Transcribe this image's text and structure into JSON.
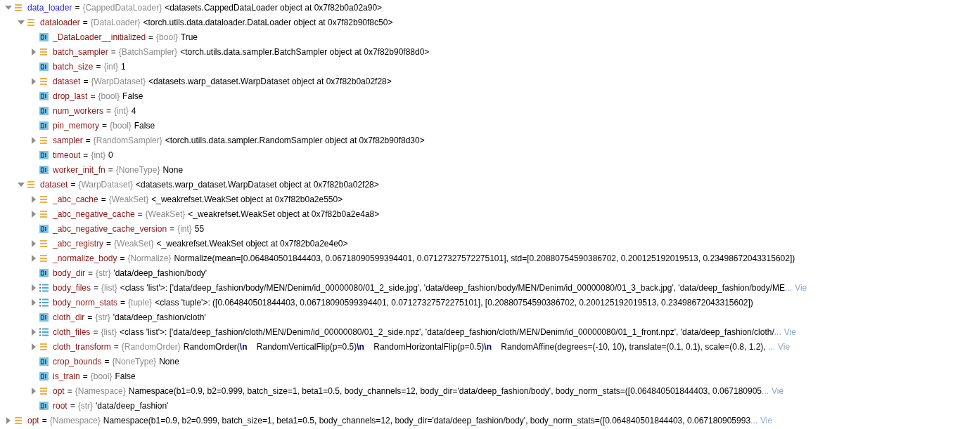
{
  "variables": [
    {
      "kind": "object",
      "name": "data_loader",
      "changed": true,
      "eq": "=",
      "type": "{CappedDataLoader}",
      "value": "<datasets.CappedDataLoader object at 0x7f82b0a02a90>",
      "expanded": true,
      "children": [
        {
          "kind": "object",
          "name": "dataloader",
          "changed": false,
          "eq": "=",
          "type": "{DataLoader}",
          "value": "<torch.utils.data.dataloader.DataLoader object at 0x7f82b90f8c50>",
          "expanded": true,
          "children": [
            {
              "kind": "primitive",
              "name": "_DataLoader__initialized",
              "changed": false,
              "eq": "=",
              "type": "{bool}",
              "value": "True"
            },
            {
              "kind": "object",
              "name": "batch_sampler",
              "changed": false,
              "eq": "=",
              "type": "{BatchSampler}",
              "value": "<torch.utils.data.sampler.BatchSampler object at 0x7f82b90f88d0>",
              "expanded": false
            },
            {
              "kind": "primitive",
              "name": "batch_size",
              "changed": false,
              "eq": "=",
              "type": "{int}",
              "value": "1"
            },
            {
              "kind": "object",
              "name": "dataset",
              "changed": false,
              "eq": "=",
              "type": "{WarpDataset}",
              "value": "<datasets.warp_dataset.WarpDataset object at 0x7f82b0a02f28>",
              "expanded": false
            },
            {
              "kind": "primitive",
              "name": "drop_last",
              "changed": false,
              "eq": "=",
              "type": "{bool}",
              "value": "False"
            },
            {
              "kind": "primitive",
              "name": "num_workers",
              "changed": false,
              "eq": "=",
              "type": "{int}",
              "value": "4"
            },
            {
              "kind": "primitive",
              "name": "pin_memory",
              "changed": false,
              "eq": "=",
              "type": "{bool}",
              "value": "False"
            },
            {
              "kind": "object",
              "name": "sampler",
              "changed": false,
              "eq": "=",
              "type": "{RandomSampler}",
              "value": "<torch.utils.data.sampler.RandomSampler object at 0x7f82b90f8d30>",
              "expanded": false
            },
            {
              "kind": "primitive",
              "name": "timeout",
              "changed": false,
              "eq": "=",
              "type": "{int}",
              "value": "0"
            },
            {
              "kind": "primitive",
              "name": "worker_init_fn",
              "changed": false,
              "eq": "=",
              "type": "{NoneType}",
              "value": "None"
            }
          ]
        },
        {
          "kind": "object",
          "name": "dataset",
          "changed": false,
          "eq": "=",
          "type": "{WarpDataset}",
          "value": "<datasets.warp_dataset.WarpDataset object at 0x7f82b0a02f28>",
          "expanded": true,
          "children": [
            {
              "kind": "object",
              "name": "_abc_cache",
              "changed": false,
              "eq": "=",
              "type": "{WeakSet}",
              "value": "<_weakrefset.WeakSet object at 0x7f82b0a2e550>",
              "expanded": false
            },
            {
              "kind": "object",
              "name": "_abc_negative_cache",
              "changed": false,
              "eq": "=",
              "type": "{WeakSet}",
              "value": "<_weakrefset.WeakSet object at 0x7f82b0a2e4a8>",
              "expanded": false
            },
            {
              "kind": "primitive",
              "name": "_abc_negative_cache_version",
              "changed": false,
              "eq": "=",
              "type": "{int}",
              "value": "55"
            },
            {
              "kind": "object",
              "name": "_abc_registry",
              "changed": false,
              "eq": "=",
              "type": "{WeakSet}",
              "value": "<_weakrefset.WeakSet object at 0x7f82b0a2e4e0>",
              "expanded": false
            },
            {
              "kind": "object",
              "name": "_normalize_body",
              "changed": false,
              "eq": "=",
              "type": "{Normalize}",
              "value": "Normalize(mean=[0.064840501844403, 0.06718090599394401, 0.07127327572275101], std=[0.20880754590386702, 0.200125192019513, 0.23498672043315602])",
              "expanded": false
            },
            {
              "kind": "primitive",
              "name": "body_dir",
              "changed": false,
              "eq": "=",
              "type": "{str}",
              "value": "'data/deep_fashion/body'"
            },
            {
              "kind": "list",
              "name": "body_files",
              "changed": false,
              "eq": "=",
              "type": "{list}",
              "value": "<class 'list'>: ['data/deep_fashion/body/MEN/Denim/id_00000080/01_2_side.jpg', 'data/deep_fashion/body/MEN/Denim/id_00000080/01_3_back.jpg', 'data/deep_fashion/body/ME",
              "ellipsis": "...",
              "link": "Vie",
              "expanded": false
            },
            {
              "kind": "list",
              "name": "body_norm_stats",
              "changed": false,
              "eq": "=",
              "type": "{tuple}",
              "value": "<class 'tuple'>: ([0.064840501844403, 0.06718090599394401, 0.07127327572275101], [0.20880754590386702, 0.200125192019513, 0.23498672043315602])",
              "expanded": false
            },
            {
              "kind": "primitive",
              "name": "cloth_dir",
              "changed": false,
              "eq": "=",
              "type": "{str}",
              "value": "'data/deep_fashion/cloth'"
            },
            {
              "kind": "list",
              "name": "cloth_files",
              "changed": false,
              "eq": "=",
              "type": "{list}",
              "value": "<class 'list'>: ['data/deep_fashion/cloth/MEN/Denim/id_00000080/01_2_side.npz', 'data/deep_fashion/cloth/MEN/Denim/id_00000080/01_1_front.npz', 'data/deep_fashion/cloth/",
              "ellipsis": "...",
              "link": "Vie",
              "expanded": false
            },
            {
              "kind": "object",
              "name": "cloth_transform",
              "changed": false,
              "eq": "=",
              "type": "{RandomOrder}",
              "value": "RandomOrder(**\\n**    RandomVerticalFlip(p=0.5)**\\n**    RandomHorizontalFlip(p=0.5)**\\n**    RandomAffine(degrees=(-10, 10), translate=(0.1, 0.1), scale=(0.8, 1.2), ",
              "ellipsis": "...",
              "link": "Vie",
              "expanded": false
            },
            {
              "kind": "primitive",
              "name": "crop_bounds",
              "changed": false,
              "eq": "=",
              "type": "{NoneType}",
              "value": "None"
            },
            {
              "kind": "primitive",
              "name": "is_train",
              "changed": false,
              "eq": "=",
              "type": "{bool}",
              "value": "False"
            },
            {
              "kind": "object",
              "name": "opt",
              "changed": false,
              "eq": "=",
              "type": "{Namespace}",
              "value": "Namespace(b1=0.9, b2=0.999, batch_size=1, beta1=0.5, body_channels=12, body_dir='data/deep_fashion/body', body_norm_stats=([0.064840501844403, 0.067180905",
              "ellipsis": "...",
              "link": "Vie",
              "expanded": false
            },
            {
              "kind": "primitive",
              "name": "root",
              "changed": false,
              "eq": "=",
              "type": "{str}",
              "value": "'data/deep_fashion'"
            }
          ]
        }
      ]
    },
    {
      "kind": "object",
      "name": "opt",
      "changed": false,
      "eq": "=",
      "type": "{Namespace}",
      "value": "Namespace(b1=0.9, b2=0.999, batch_size=1, beta1=0.5, body_channels=12, body_dir='data/deep_fashion/body', body_norm_stats=([0.064840501844403, 0.067180905993",
      "ellipsis": "...",
      "link": "Vie",
      "expanded": false
    }
  ]
}
